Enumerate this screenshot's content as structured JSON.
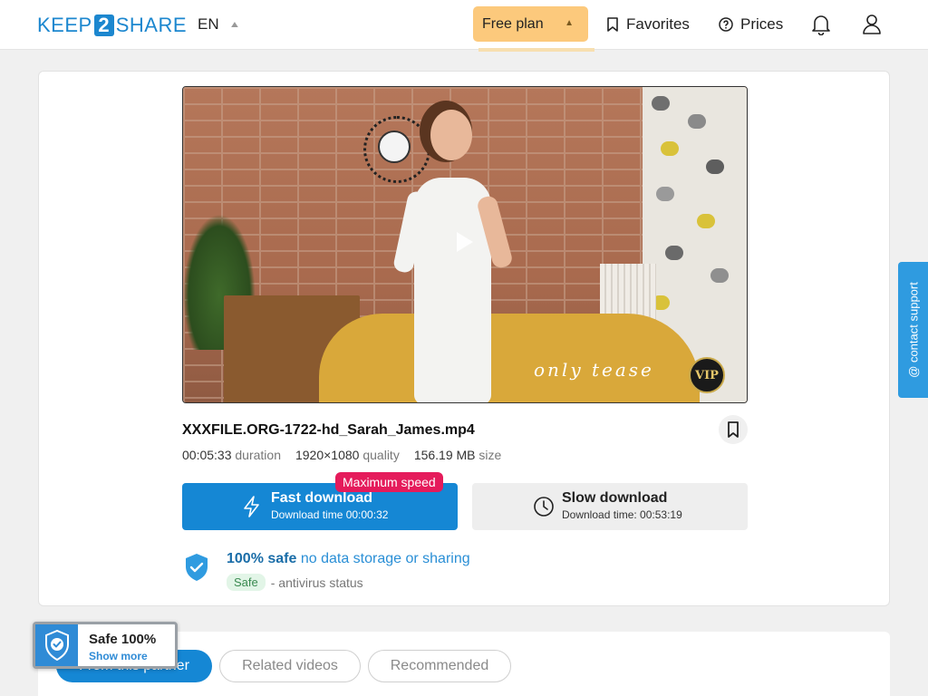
{
  "header": {
    "logo": {
      "left": "KEEP",
      "box": "2",
      "right": "SHARE"
    },
    "language": "EN",
    "plan_label": "Free plan",
    "favorites_label": "Favorites",
    "prices_label": "Prices"
  },
  "file": {
    "name": "XXXFILE.ORG-1722-hd_Sarah_James.mp4",
    "duration_value": "00:05:33",
    "duration_label": "duration",
    "quality_value": "1920×1080",
    "quality_label": "quality",
    "size_value": "156.19 MB",
    "size_label": "size",
    "watermark": "only tease",
    "vip_label": "VIP"
  },
  "download": {
    "fast_title": "Fast download",
    "fast_sub": "Download time 00:00:32",
    "badge": "Maximum speed",
    "slow_title": "Slow download",
    "slow_sub": "Download time: 00:53:19"
  },
  "safety": {
    "strong": "100% safe",
    "rest": "no data storage or sharing",
    "pill": "Safe",
    "status_text": "- antivirus status"
  },
  "contact_label": "@ contact support",
  "tabs": [
    {
      "label": "From this partner"
    },
    {
      "label": "Related videos"
    },
    {
      "label": "Recommended"
    }
  ],
  "safe_badge": {
    "title": "Safe 100%",
    "link": "Show more"
  },
  "colors": {
    "accent": "#1587d4",
    "plan": "#fcc97c",
    "badge": "#e51b5b"
  }
}
